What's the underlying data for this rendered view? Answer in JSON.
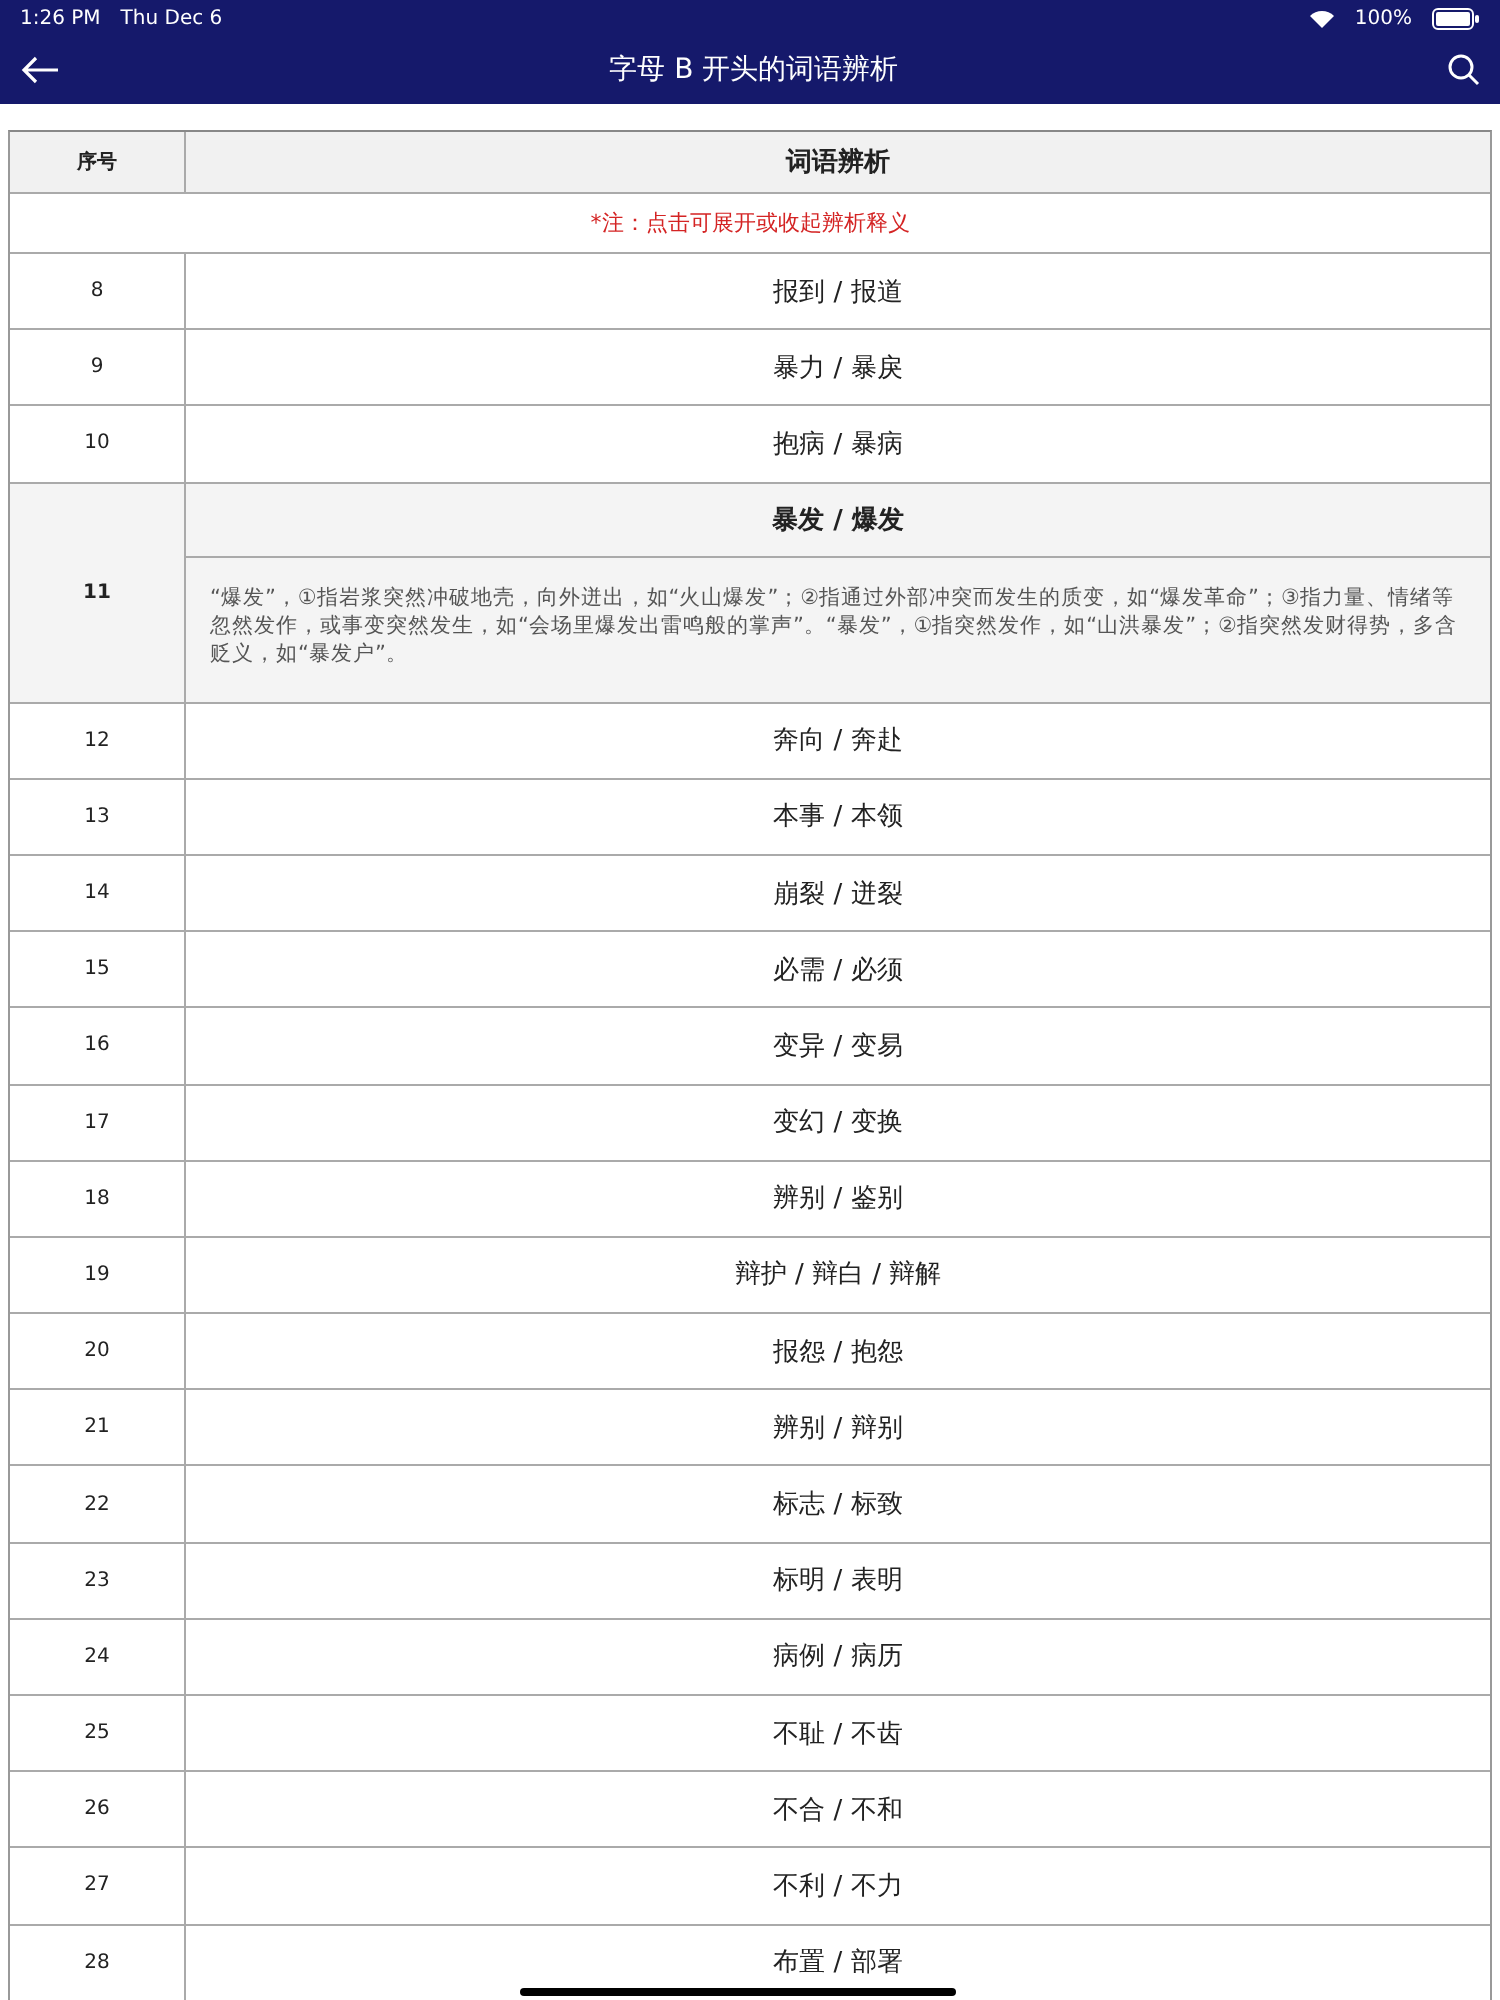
{
  "status_bar": {
    "time": "1:26 PM",
    "date": "Thu Dec 6",
    "battery": "100%"
  },
  "nav": {
    "title": "字母 B 开头的词语辨析"
  },
  "table": {
    "columns": [
      "序号",
      "词语辨析"
    ],
    "note": "*注：点击可展开或收起辨析释义",
    "rows": [
      {
        "number": "8",
        "words": "报到 / 报道",
        "expanded": false
      },
      {
        "number": "9",
        "words": "暴力 / 暴戾",
        "expanded": false
      },
      {
        "number": "10",
        "words": "抱病 / 暴病",
        "expanded": false
      },
      {
        "number": "11",
        "words": "暴发 / 爆发",
        "expanded": true,
        "explanation": "“爆发”，①指岩浆突然冲破地壳，向外迸出，如“火山爆发”；②指通过外部冲突而发生的质变，如“爆发革命”；③指力量、情绪等忽然发作，或事变突然发生，如“会场里爆发出雷鸣般的掌声”。“暴发”，①指突然发作，如“山洪暴发”；②指突然发财得势，多含贬义，如“暴发户”。"
      },
      {
        "number": "12",
        "words": "奔向 / 奔赴",
        "expanded": false
      },
      {
        "number": "13",
        "words": "本事 / 本领",
        "expanded": false
      },
      {
        "number": "14",
        "words": "崩裂 / 迸裂",
        "expanded": false
      },
      {
        "number": "15",
        "words": "必需 / 必须",
        "expanded": false
      },
      {
        "number": "16",
        "words": "变异 / 变易",
        "expanded": false
      },
      {
        "number": "17",
        "words": "变幻 / 变换",
        "expanded": false
      },
      {
        "number": "18",
        "words": "辨别 / 鉴别",
        "expanded": false
      },
      {
        "number": "19",
        "words": "辩护 / 辩白 / 辩解",
        "expanded": false
      },
      {
        "number": "20",
        "words": "报怨 / 抱怨",
        "expanded": false
      },
      {
        "number": "21",
        "words": "辨别 / 辩别",
        "expanded": false
      },
      {
        "number": "22",
        "words": "标志 / 标致",
        "expanded": false
      },
      {
        "number": "23",
        "words": "标明 / 表明",
        "expanded": false
      },
      {
        "number": "24",
        "words": "病例 / 病历",
        "expanded": false
      },
      {
        "number": "25",
        "words": "不耻 / 不齿",
        "expanded": false
      },
      {
        "number": "26",
        "words": "不合 / 不和",
        "expanded": false
      },
      {
        "number": "27",
        "words": "不利 / 不力",
        "expanded": false
      },
      {
        "number": "28",
        "words": "布置 / 部署",
        "expanded": false
      }
    ]
  }
}
